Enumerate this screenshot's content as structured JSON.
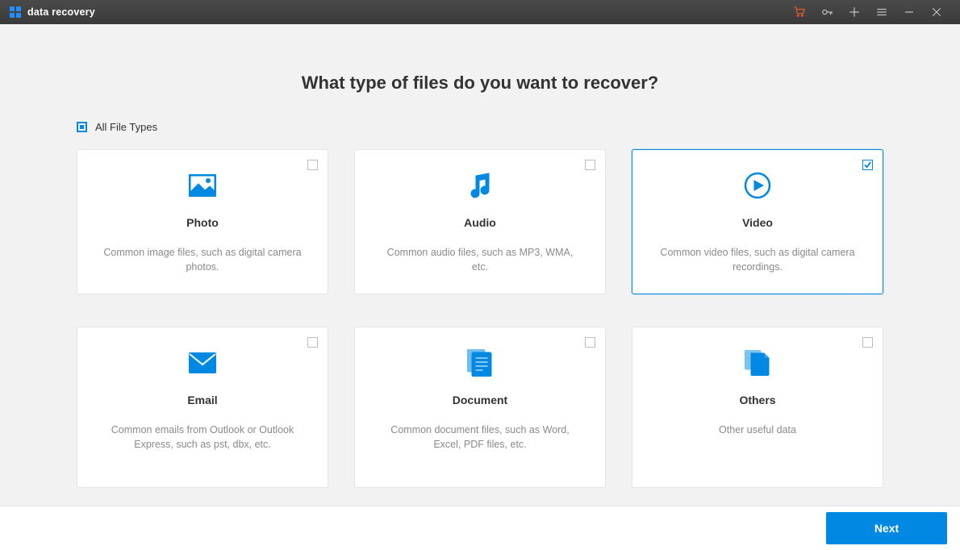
{
  "title": "data recovery",
  "heading": "What type of files do you want to recover?",
  "all_label": "All File Types",
  "cards": [
    {
      "title": "Photo",
      "desc": "Common image files, such as digital camera photos.",
      "selected": false
    },
    {
      "title": "Audio",
      "desc": "Common audio files, such as MP3, WMA, etc.",
      "selected": false
    },
    {
      "title": "Video",
      "desc": "Common video files, such as digital camera recordings.",
      "selected": true
    },
    {
      "title": "Email",
      "desc": "Common emails from Outlook or Outlook Express, such as pst, dbx, etc.",
      "selected": false
    },
    {
      "title": "Document",
      "desc": "Common document files, such as Word, Excel, PDF files, etc.",
      "selected": false
    },
    {
      "title": "Others",
      "desc": "Other useful data",
      "selected": false
    }
  ],
  "next_label": "Next",
  "colors": {
    "accent": "#0088e2"
  }
}
